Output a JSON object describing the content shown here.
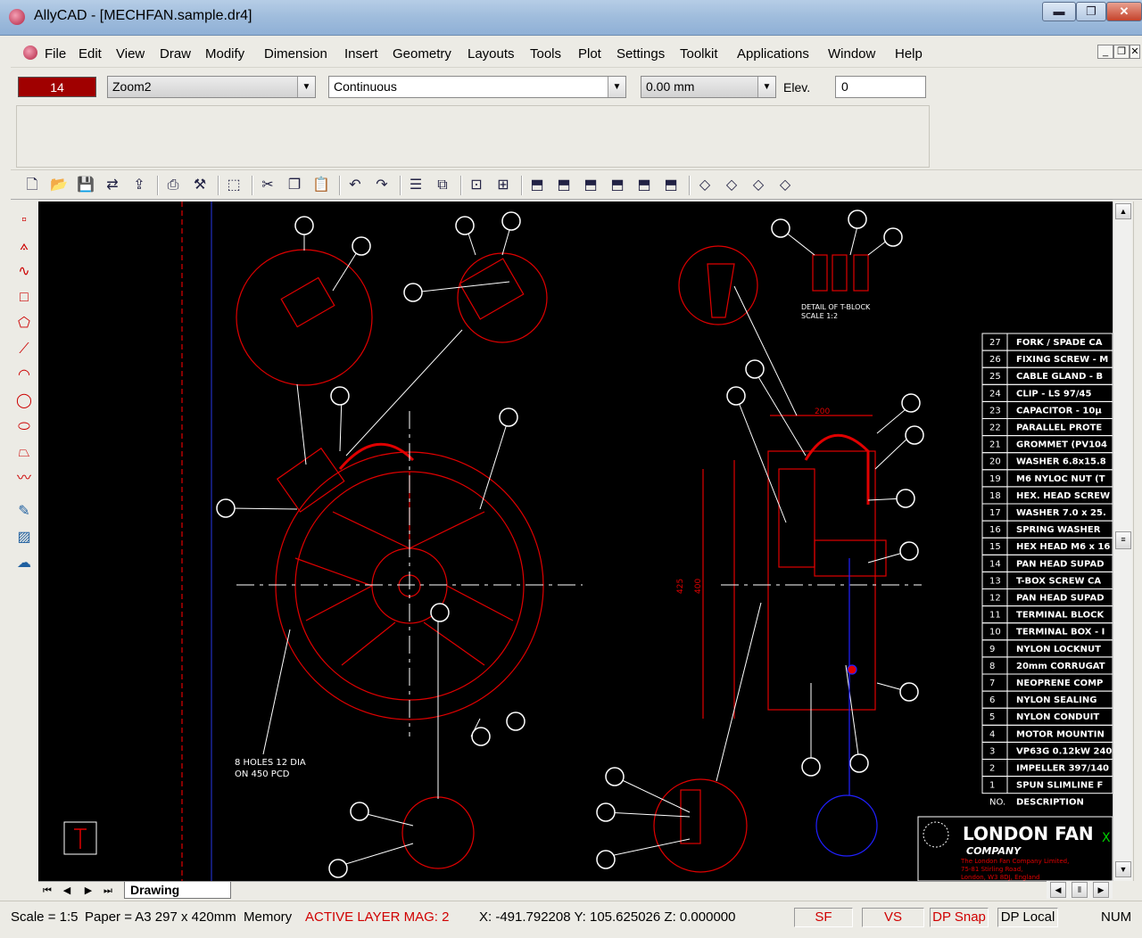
{
  "window": {
    "title": "AllyCAD - [MECHFAN.sample.dr4]",
    "min": "▬",
    "max": "❐",
    "close": "✕"
  },
  "menu": {
    "items": [
      "File",
      "Edit",
      "View",
      "Draw",
      "Modify",
      "Dimension",
      "Insert",
      "Geometry",
      "Layouts",
      "Tools",
      "Plot",
      "Settings",
      "Toolkit",
      "Applications",
      "Window",
      "Help"
    ],
    "mdi_min": "_",
    "mdi_restore": "❐",
    "mdi_close": "✕"
  },
  "props": {
    "color_value": "14",
    "layer": "Zoom2",
    "linetype": "Continuous",
    "line_width": "0.00 mm",
    "elev_label": "Elev.",
    "elev_value": "0",
    "arrow": "▼"
  },
  "toolbar_icons": [
    "new-icon",
    "open-icon",
    "save-icon",
    "drc-icon",
    "txt-icon",
    "print-icon",
    "tools-icon",
    "select-icon",
    "cut-icon",
    "copy-icon",
    "paste-icon",
    "undo-icon",
    "redo-icon",
    "layers-icon",
    "layers2-icon",
    "zoom-window-icon",
    "zoom-extents-icon",
    "view-front-icon",
    "view-back-icon",
    "view-top-icon",
    "view-bottom-icon",
    "view-left-icon",
    "view-right-icon",
    "iso-ne-icon",
    "iso-nw-icon",
    "iso-se-icon",
    "iso-sw-icon"
  ],
  "left_tools": [
    "point-icon",
    "polyline-icon",
    "spline-icon",
    "rectangle-icon",
    "polygon-icon",
    "multiline-icon",
    "arc-icon",
    "circle-icon",
    "ellipse-icon",
    "trapezoid-icon",
    "curve-icon",
    "dimension-icon",
    "hatch-icon",
    "cloud-icon"
  ],
  "drawing": {
    "notes_holes": [
      "8 HOLES 12 DIA",
      "ON 450 PCD"
    ],
    "tblock_label": [
      "DETAIL OF T-BLOCK",
      "SCALE 1:2"
    ],
    "dim_200": "200",
    "dim_425": "425",
    "dim_400": "400",
    "axis_x": "X",
    "company_name": "LONDON FAN",
    "company_sub": "COMPANY",
    "company_address": [
      "The London Fan Company Limited,",
      "75-81 Stirling Road,",
      "London, W3 8DJ, England"
    ]
  },
  "parts_list": {
    "header_no": "NO.",
    "header_desc": "DESCRIPTION",
    "rows": [
      [
        "27",
        "FORK / SPADE CA"
      ],
      [
        "26",
        "FIXING SCREW - M"
      ],
      [
        "25",
        "CABLE GLAND - B"
      ],
      [
        "24",
        "CLIP - LS 97/45"
      ],
      [
        "23",
        "CAPACITOR - 10µ"
      ],
      [
        "22",
        "PARALLEL PROTE"
      ],
      [
        "21",
        "GROMMET (PV104"
      ],
      [
        "20",
        "WASHER 6.8x15.8"
      ],
      [
        "19",
        "M6 NYLOC NUT (T"
      ],
      [
        "18",
        "HEX. HEAD SCREW"
      ],
      [
        "17",
        "WASHER 7.0 x 25."
      ],
      [
        "16",
        "SPRING WASHER"
      ],
      [
        "15",
        "HEX HEAD M6 x 16"
      ],
      [
        "14",
        "PAN HEAD SUPAD"
      ],
      [
        "13",
        "T-BOX SCREW CA"
      ],
      [
        "12",
        "PAN HEAD SUPAD"
      ],
      [
        "11",
        "TERMINAL BLOCK"
      ],
      [
        "10",
        "TERMINAL BOX - I"
      ],
      [
        "9",
        "NYLON LOCKNUT"
      ],
      [
        "8",
        "20mm CORRUGAT"
      ],
      [
        "7",
        "NEOPRENE COMP"
      ],
      [
        "6",
        "NYLON SEALING"
      ],
      [
        "5",
        "NYLON CONDUIT"
      ],
      [
        "4",
        "MOTOR MOUNTIN"
      ],
      [
        "3",
        "VP63G 0.12kW 240"
      ],
      [
        "2",
        "IMPELLER 397/140"
      ],
      [
        "1",
        "SPUN SLIMLINE F"
      ]
    ]
  },
  "tabs": {
    "first": "⏮",
    "prev": "◀",
    "next": "▶",
    "last": "⏭",
    "active": "Drawing"
  },
  "status": {
    "scale": "Scale = 1:5",
    "paper": "Paper = A3 297 x 420mm",
    "memory": "Memory",
    "active_layer": "ACTIVE LAYER MAG: 2",
    "coords": "X: -491.792208 Y: 105.625026 Z: 0.000000",
    "sf": "SF",
    "vs": "VS",
    "dp_snap": "DP Snap",
    "dp_local": "DP Local",
    "num": "NUM"
  },
  "colors": {
    "red": "#e00000",
    "white": "#ffffff",
    "blue": "#2020ff",
    "active_layer": "#d00000",
    "green": "#00d000"
  }
}
